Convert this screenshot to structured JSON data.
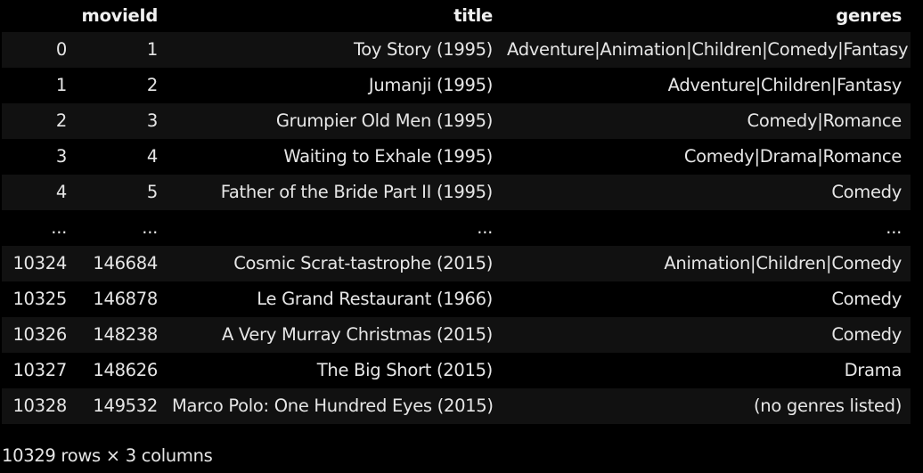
{
  "table": {
    "columns": [
      "",
      "movieId",
      "title",
      "genres"
    ],
    "rows": [
      [
        "0",
        "1",
        "Toy Story (1995)",
        "Adventure|Animation|Children|Comedy|Fantasy"
      ],
      [
        "1",
        "2",
        "Jumanji (1995)",
        "Adventure|Children|Fantasy"
      ],
      [
        "2",
        "3",
        "Grumpier Old Men (1995)",
        "Comedy|Romance"
      ],
      [
        "3",
        "4",
        "Waiting to Exhale (1995)",
        "Comedy|Drama|Romance"
      ],
      [
        "4",
        "5",
        "Father of the Bride Part II (1995)",
        "Comedy"
      ],
      [
        "...",
        "...",
        "...",
        "..."
      ],
      [
        "10324",
        "146684",
        "Cosmic Scrat-tastrophe (2015)",
        "Animation|Children|Comedy"
      ],
      [
        "10325",
        "146878",
        "Le Grand Restaurant (1966)",
        "Comedy"
      ],
      [
        "10326",
        "148238",
        "A Very Murray Christmas (2015)",
        "Comedy"
      ],
      [
        "10327",
        "148626",
        "The Big Short (2015)",
        "Drama"
      ],
      [
        "10328",
        "149532",
        "Marco Polo: One Hundred Eyes (2015)",
        "(no genres listed)"
      ]
    ]
  },
  "shape_text": "10329 rows × 3 columns"
}
